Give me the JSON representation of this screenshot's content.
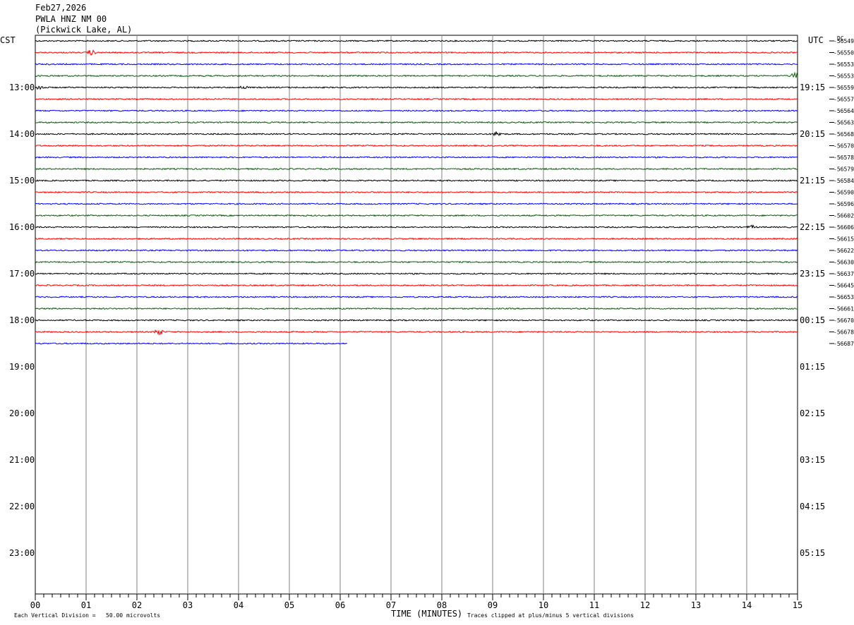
{
  "header": {
    "date": "Feb27,2026",
    "station": "PWLA HNZ NM 00",
    "location": "(Pickwick Lake, AL)"
  },
  "left_tz": "CST",
  "right_tz": "UTC",
  "dc_label": "DC",
  "footer": {
    "scale_note": "Each Vertical Division =   50.00 microvolts",
    "xlabel": "TIME (MINUTES)",
    "clip_note": "Traces clipped at plus/minus 5 vertical divisions"
  },
  "chart_data": {
    "type": "line",
    "xlabel": "TIME (MINUTES)",
    "xlim": [
      0,
      15
    ],
    "x_ticks": [
      "00",
      "01",
      "02",
      "03",
      "04",
      "05",
      "06",
      "07",
      "08",
      "09",
      "10",
      "11",
      "12",
      "13",
      "14",
      "15"
    ],
    "left_hour_labels": [
      "13:00",
      "14:00",
      "15:00",
      "16:00",
      "17:00",
      "18:00",
      "19:00",
      "20:00",
      "21:00",
      "22:00",
      "23:00"
    ],
    "right_hour_labels": [
      "19:15",
      "20:15",
      "21:15",
      "22:15",
      "23:15",
      "00:15",
      "01:15",
      "02:15",
      "03:15",
      "04:15",
      "05:15"
    ],
    "rows_per_hour": 4,
    "total_rows": 48,
    "first_row_time": "12:00",
    "color_cycle": [
      "#000000",
      "#ff0000",
      "#0000ff",
      "#006400"
    ],
    "traces": [
      {
        "row": 0,
        "dc": "-56549",
        "end_minute": 15
      },
      {
        "row": 1,
        "dc": "-56550",
        "end_minute": 15,
        "events": [
          [
            1.1,
            3.5
          ]
        ]
      },
      {
        "row": 2,
        "dc": "-56553",
        "end_minute": 15
      },
      {
        "row": 3,
        "dc": "-56553",
        "end_minute": 15,
        "events": [
          [
            14.95,
            4
          ]
        ]
      },
      {
        "row": 4,
        "dc": "-56559",
        "end_minute": 15,
        "events": [
          [
            0.1,
            3
          ],
          [
            4.1,
            2
          ]
        ]
      },
      {
        "row": 5,
        "dc": "-56557",
        "end_minute": 15
      },
      {
        "row": 6,
        "dc": "-56564",
        "end_minute": 15
      },
      {
        "row": 7,
        "dc": "-56563",
        "end_minute": 15
      },
      {
        "row": 8,
        "dc": "-56568",
        "end_minute": 15,
        "events": [
          [
            9.1,
            4
          ]
        ]
      },
      {
        "row": 9,
        "dc": "-56570",
        "end_minute": 15
      },
      {
        "row": 10,
        "dc": "-56578",
        "end_minute": 15
      },
      {
        "row": 11,
        "dc": "-56579",
        "end_minute": 15
      },
      {
        "row": 12,
        "dc": "-56584",
        "end_minute": 15
      },
      {
        "row": 13,
        "dc": "-56590",
        "end_minute": 15
      },
      {
        "row": 14,
        "dc": "-56596",
        "end_minute": 15
      },
      {
        "row": 15,
        "dc": "-56602",
        "end_minute": 15
      },
      {
        "row": 16,
        "dc": "-56606",
        "end_minute": 15,
        "events": [
          [
            14.1,
            2
          ]
        ]
      },
      {
        "row": 17,
        "dc": "-56615",
        "end_minute": 15
      },
      {
        "row": 18,
        "dc": "-56622",
        "end_minute": 15
      },
      {
        "row": 19,
        "dc": "-56630",
        "end_minute": 15
      },
      {
        "row": 20,
        "dc": "-56637",
        "end_minute": 15
      },
      {
        "row": 21,
        "dc": "-56645",
        "end_minute": 15
      },
      {
        "row": 22,
        "dc": "-56653",
        "end_minute": 15
      },
      {
        "row": 23,
        "dc": "-56661",
        "end_minute": 15
      },
      {
        "row": 24,
        "dc": "-56670",
        "end_minute": 15
      },
      {
        "row": 25,
        "dc": "-56678",
        "end_minute": 15,
        "events": [
          [
            2.43,
            5
          ]
        ]
      },
      {
        "row": 26,
        "dc": "-56687",
        "end_minute": 6.15
      }
    ]
  }
}
